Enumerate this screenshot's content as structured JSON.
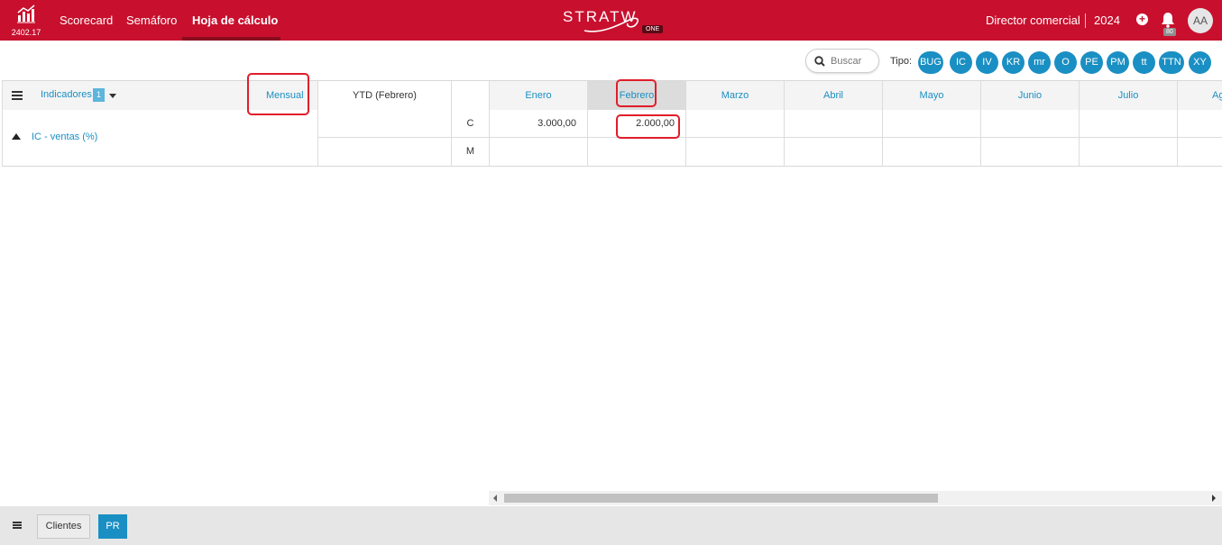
{
  "topbar": {
    "version": "2402.17",
    "nav": [
      {
        "label": "Scorecard"
      },
      {
        "label": "Semáforo"
      },
      {
        "label": "Hoja de cálculo",
        "active": true
      }
    ],
    "brand": "STRATW",
    "brand_badge": "ONE",
    "role": "Director comercial",
    "year": "2024",
    "notification_count": "80",
    "avatar_initials": "AA"
  },
  "filters": {
    "search_placeholder": "Buscar",
    "tipo_label": "Tipo:",
    "chips": [
      "BUG",
      "IC",
      "IV",
      "KR",
      "mr",
      "O",
      "PE",
      "PM",
      "tt",
      "TTN",
      "XY"
    ]
  },
  "grid": {
    "indicators_label": "Indicadores",
    "indicators_count": "1",
    "period_label": "Mensual",
    "ytd_label": "YTD (Febrero)",
    "months": [
      "Enero",
      "Febrero",
      "Marzo",
      "Abril",
      "Mayo",
      "Junio",
      "Julio",
      "Ag"
    ],
    "selected_month": "Febrero",
    "rows": [
      {
        "indicator": "IC - ventas (%)",
        "series": [
          {
            "type": "C",
            "values": [
              "3.000,00",
              "2.000,00",
              "",
              "",
              "",
              "",
              "",
              ""
            ]
          },
          {
            "type": "M",
            "values": [
              "",
              "",
              "",
              "",
              "",
              "",
              "",
              ""
            ]
          }
        ]
      }
    ]
  },
  "bottombar": {
    "tabs": [
      {
        "label": "Clientes",
        "active": false
      },
      {
        "label": "PR",
        "active": true
      }
    ]
  },
  "colors": {
    "topbar": "#c8102e",
    "accent": "#1a8fc3",
    "highlight": "#e11d2a"
  }
}
